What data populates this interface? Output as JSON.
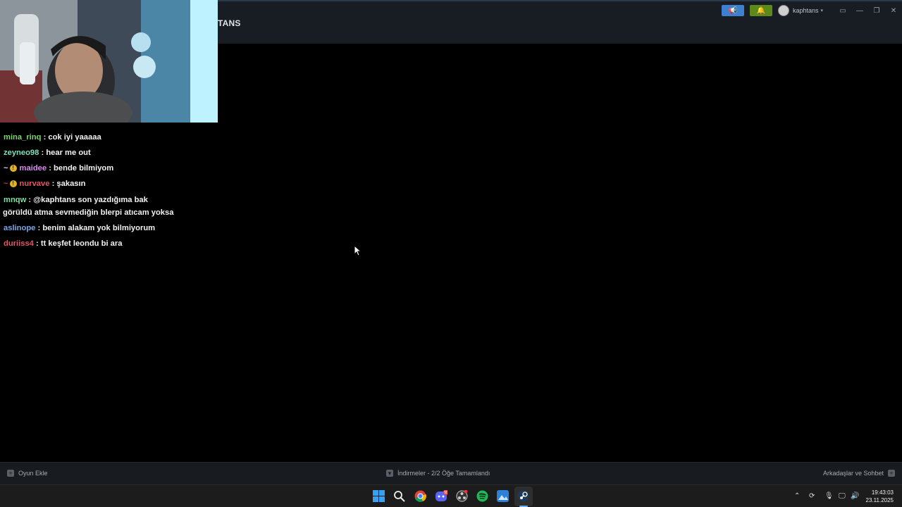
{
  "header": {
    "title": "TANS",
    "username": "kaphtans"
  },
  "chat": {
    "messages": [
      {
        "user": "mina_rinq",
        "text": " : cok iyi yaaaaa",
        "color": "#7ed56f"
      },
      {
        "user": "zeyneo98",
        "text": " : hear me out",
        "color": "#7fe0c0"
      },
      {
        "user": "maidee",
        "text": " : bende bilmiyom",
        "color": "#d98cf0",
        "badge": true
      },
      {
        "user": "nurvave",
        "text": " : şakasın",
        "color": "#e0566b",
        "badge": true
      },
      {
        "user": "mnqw",
        "text": " : @kaphtans son yazdığıma bak",
        "text2": "görüldü atma sevmediğin blerpi atıcam yoksa",
        "color": "#7fe0a0"
      },
      {
        "user": "aslinope",
        "text": " : benim alakam yok bilmiyorum",
        "color": "#7aa6e8"
      },
      {
        "user": "duriiss4",
        "text": " : tt keşfet leondu bi ara",
        "color": "#e0566b"
      }
    ]
  },
  "bottom": {
    "add_game": "Oyun Ekle",
    "downloads": "İndirmeler - 2/2 Öğe Tamamlandı",
    "friends": "Arkadaşlar ve Sohbet"
  },
  "taskbar": {
    "time": "19:43:03",
    "date": "23.11.2025",
    "discord_badge": "99"
  },
  "colors": {
    "announce": "#3d7fd1",
    "notify": "#5c8a1a"
  }
}
